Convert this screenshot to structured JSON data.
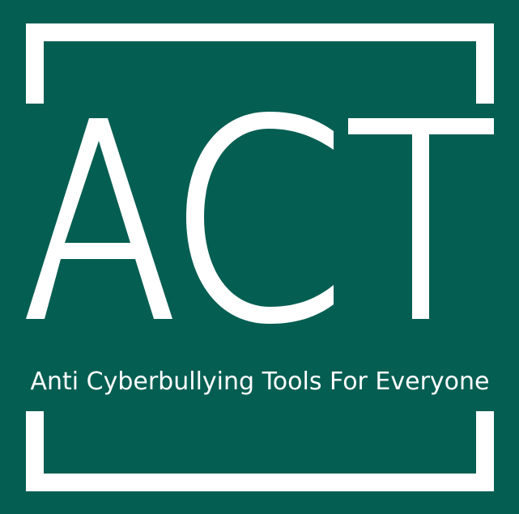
{
  "logo": {
    "wordmark": "ACT",
    "tagline": "Anti Cyberbullying Tools For Everyone"
  },
  "colors": {
    "background": "#055e52",
    "foreground": "#ffffff"
  }
}
